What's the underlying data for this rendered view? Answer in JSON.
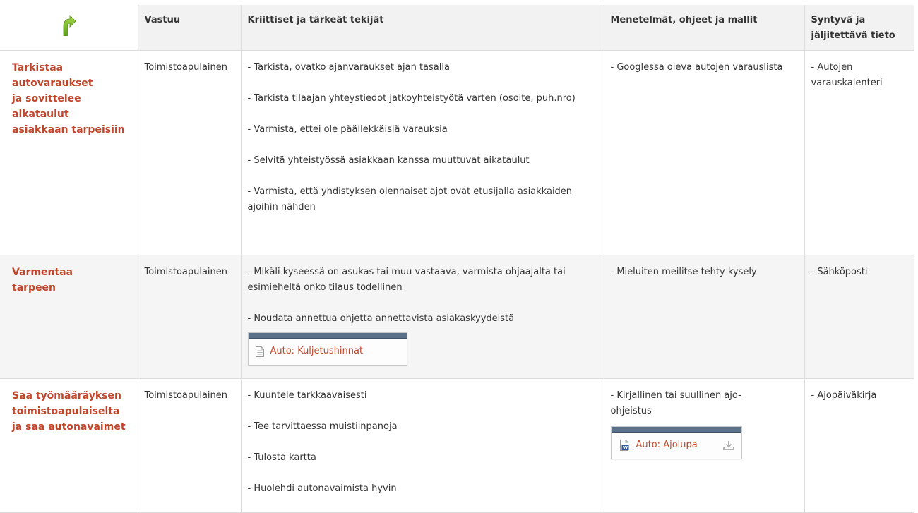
{
  "header": {
    "arrow_icon": "green-curved-arrow-icon",
    "columns": [
      "Vastuu",
      "Kriittiset ja tärkeät tekijät",
      "Menetelmät, ohjeet ja mallit",
      "Syntyvä ja jäljitettävä tieto"
    ]
  },
  "rows": [
    {
      "step": "Tarkistaa\nautovaraukset\nja sovittelee\naikataulut\nasiakkaan tarpeisiin",
      "responsible": "Toimistoapulainen",
      "critical": [
        "- Tarkista, ovatko ajanvaraukset ajan tasalla",
        "- Tarkista tilaajan yhteystiedot jatkoyhteistyötä varten (osoite, puh.nro)",
        "- Varmista, ettei ole päällekkäisiä varauksia",
        "- Selvitä yhteistyössä asiakkaan kanssa muuttuvat aikataulut",
        "- Varmista, että yhdistyksen olennaiset ajot ovat etusijalla asiakkaiden ajoihin nähden"
      ],
      "methods": "- Googlessa oleva autojen varauslista",
      "info": "- Autojen varauskalenteri"
    },
    {
      "step": "Varmentaa\ntarpeen",
      "responsible": "Toimistoapulainen",
      "critical": [
        "- Mikäli kyseessä on asukas tai muu vastaava, varmista ohjaajalta tai esimieheltä onko tilaus todellinen",
        "- Noudata annettua ohjetta annettavista asiakaskyydeistä"
      ],
      "critical_attachment": "Auto: Kuljetushinnat",
      "methods": "- Mieluiten meilitse tehty kysely",
      "info": "- Sähköposti"
    },
    {
      "step": "Saa työmääräyksen\ntoimistoapulaiselta\nja saa autonavaimet",
      "responsible": "Toimistoapulainen",
      "critical": [
        "- Kuuntele tarkkaavaisesti",
        "- Tee tarvittaessa muistiinpanoja",
        "- Tulosta kartta",
        "- Huolehdi autonavaimista hyvin"
      ],
      "methods": "- Kirjallinen tai suullinen ajo-ohjeistus",
      "methods_attachment": "Auto: Ajolupa",
      "info": "- Ajopäiväkirja"
    }
  ],
  "colors": {
    "step_text": "#c0462b",
    "attachment_bar": "#5b7089",
    "header_bg": "#f2f2f2",
    "alt_row_bg": "#f5f5f5",
    "arrow_green": "#7cbf2a"
  }
}
